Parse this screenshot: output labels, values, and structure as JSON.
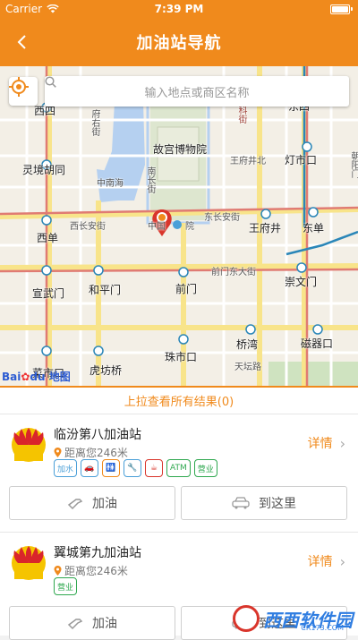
{
  "status_bar": {
    "carrier": "Carrier",
    "time": "7:39 PM"
  },
  "nav": {
    "title": "加油站导航"
  },
  "search": {
    "placeholder": "输入地点或商区名称"
  },
  "map": {
    "labels": {
      "xisi": "西四",
      "fuyoujie": "府右街",
      "gugong": "故宫博物院",
      "wangfujingbei": "王府井北",
      "dongsi": "东四",
      "dengshikou": "灯市口",
      "lingjinghutong": "灵境胡同",
      "zhongnanhai": "中南海",
      "nanchangjie": "南长街",
      "chaoyangmen": "朝阳门",
      "xichanganjie": "西长安街",
      "dongchanganjie": "东长安街",
      "wangfujing": "王府井",
      "dongdan": "东单",
      "xidan": "西单",
      "qianmendongdajie": "前门东大街",
      "xuanwumen": "宣武门",
      "hepingmen": "和平门",
      "qianmen": "前门",
      "chongwenmen": "崇文门",
      "qiaowan": "桥湾",
      "ciqikou": "磁器口",
      "zhushikou": "珠市口",
      "tianqiaolu": "天坛路",
      "hufangqiao": "虎坊桥",
      "caishikou": "菜市口",
      "kejie": "科街",
      "baidu": "Bai",
      "baidu_du": "du",
      "baidu_map": "地图",
      "zhongguo": "中国",
      "yu": "院"
    }
  },
  "results_bar": {
    "label": "上拉查看所有结果(0)"
  },
  "stations": [
    {
      "name": "临汾第八加油站",
      "distance": "距离您246米",
      "detail": "详情",
      "services": [
        "加水",
        "car-wash-icon",
        "toilet-icon",
        "wrench-icon",
        "cafe-icon",
        "ATM-icon",
        "营业"
      ],
      "refuel": "加油",
      "navigate": "到这里"
    },
    {
      "name": "翼城第九加油站",
      "distance": "距离您246米",
      "detail": "详情",
      "services": [
        "营业"
      ],
      "refuel": "加油",
      "navigate": "到这里"
    }
  ],
  "watermark": {
    "text": "西西软件园",
    "sub": "CR173.COM"
  },
  "colors": {
    "accent": "#f08a1c",
    "service_blue": "#4a9fd8",
    "road_yellow": "#f8e48a"
  }
}
